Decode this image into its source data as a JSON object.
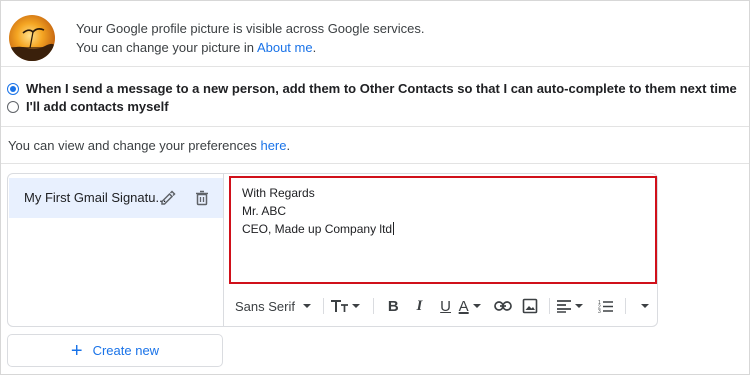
{
  "profile": {
    "line1": "Your Google profile picture is visible across Google services.",
    "line2_prefix": "You can change your picture in ",
    "line2_link": "About me",
    "line2_suffix": "."
  },
  "contacts_options": {
    "option1": "When I send a message to a new person, add them to Other Contacts so that I can auto-complete to them next time",
    "option1_checked": true,
    "option2": "I'll add contacts myself",
    "option2_checked": false
  },
  "preferences": {
    "text_prefix": "You can view and change your preferences ",
    "link": "here",
    "text_suffix": "."
  },
  "signatures": {
    "items": [
      {
        "name": "My First Gmail Signatu..."
      }
    ],
    "create_new_label": "Create new"
  },
  "editor": {
    "lines": [
      "With Regards",
      "Mr. ABC",
      "CEO, Made up Company ltd"
    ]
  },
  "toolbar": {
    "font_label": "Sans Serif",
    "size_icon": "text-size-icon",
    "bold_icon": "bold-icon",
    "italic_icon": "italic-icon",
    "underline_icon": "underline-icon",
    "text_color_icon": "text-color-icon",
    "link_icon": "link-icon",
    "image_icon": "image-icon",
    "align_icon": "align-icon",
    "numbered_list_icon": "numbered-list-icon",
    "more_icon": "more-formatting-icon"
  },
  "colors": {
    "accent": "#1a73e8",
    "highlight_border": "#d0101a",
    "selected_bg": "#e8f0fe"
  }
}
